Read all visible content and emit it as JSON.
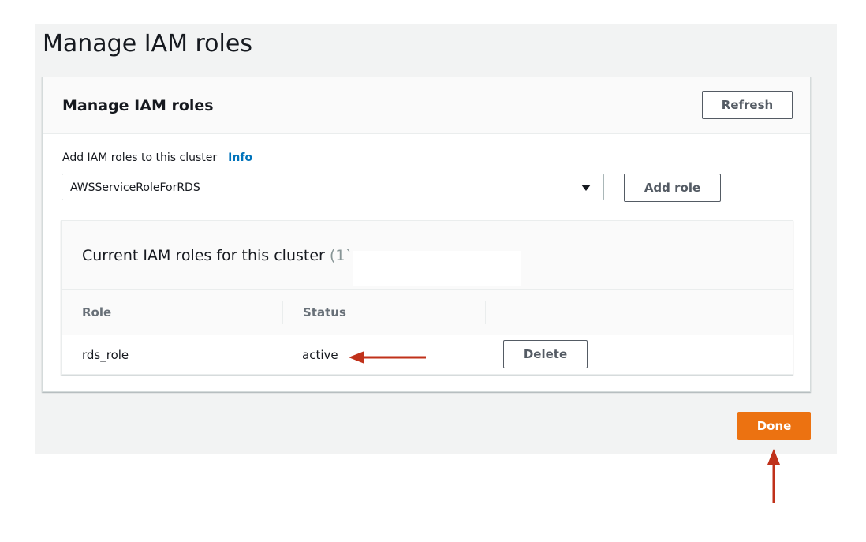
{
  "page": {
    "title": "Manage IAM roles"
  },
  "panel": {
    "title": "Manage IAM roles",
    "refresh_label": "Refresh",
    "field_label": "Add IAM roles to this cluster",
    "info_link": "Info",
    "select_value": "AWSServiceRoleForRDS",
    "add_role_label": "Add role"
  },
  "current_roles": {
    "title": "Current IAM roles for this cluster",
    "count_fragment": "(1`",
    "columns": [
      "Role",
      "Status"
    ],
    "rows": [
      {
        "role": "rds_role",
        "status": "active",
        "action_label": "Delete"
      }
    ]
  },
  "footer": {
    "done_label": "Done"
  },
  "colors": {
    "primary_button": "#ec7211",
    "link": "#0073bb",
    "annotation_arrow": "#c0311a",
    "page_background": "#f2f3f3"
  },
  "icons": {
    "select_caret": "caret-down-icon",
    "annotation_left": "arrow-left-icon",
    "annotation_up": "arrow-up-icon"
  }
}
